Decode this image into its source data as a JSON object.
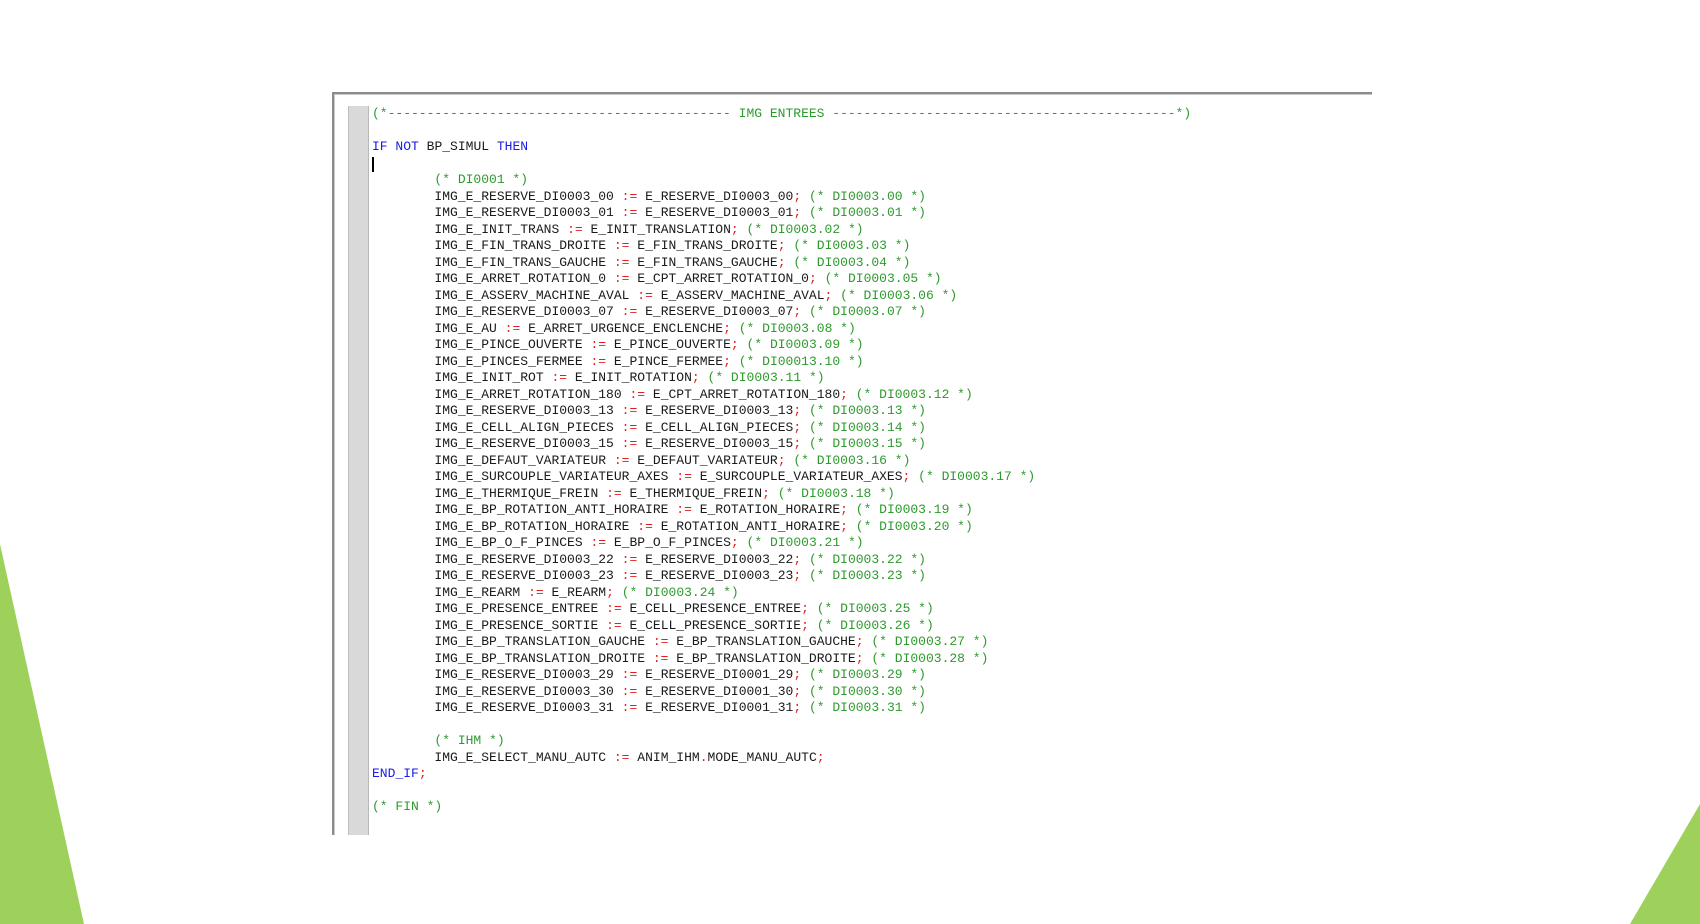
{
  "colors": {
    "keyword": "#1a1ae6",
    "comment": "#2e9a2e",
    "operator": "#e01e1e",
    "identifier": "#1a1a1a",
    "gutter": "#d9d9d9",
    "deco_green": "#9ed15b"
  },
  "code": {
    "header_comment": "(*-------------------------------------------- IMG ENTREES --------------------------------------------*)",
    "if_keyword": "IF",
    "not_keyword": "NOT",
    "condition": "BP_SIMUL",
    "then_keyword": "THEN",
    "section_di_comment": "(* DI0001 *)",
    "assignment_operator": ":=",
    "assignments": [
      {
        "lhs": "IMG_E_RESERVE_DI0003_00",
        "rhs": "E_RESERVE_DI0003_00",
        "comment": "(* DI0003.00 *)"
      },
      {
        "lhs": "IMG_E_RESERVE_DI0003_01",
        "rhs": "E_RESERVE_DI0003_01",
        "comment": "(* DI0003.01 *)"
      },
      {
        "lhs": "IMG_E_INIT_TRANS",
        "rhs": "E_INIT_TRANSLATION",
        "comment": "(* DI0003.02 *)"
      },
      {
        "lhs": "IMG_E_FIN_TRANS_DROITE",
        "rhs": "E_FIN_TRANS_DROITE",
        "comment": "(* DI0003.03 *)"
      },
      {
        "lhs": "IMG_E_FIN_TRANS_GAUCHE",
        "rhs": "E_FIN_TRANS_GAUCHE",
        "comment": "(* DI0003.04 *)"
      },
      {
        "lhs": "IMG_E_ARRET_ROTATION_0",
        "rhs": "E_CPT_ARRET_ROTATION_0",
        "comment": "(* DI0003.05 *)"
      },
      {
        "lhs": "IMG_E_ASSERV_MACHINE_AVAL",
        "rhs": "E_ASSERV_MACHINE_AVAL",
        "comment": "(* DI0003.06 *)"
      },
      {
        "lhs": "IMG_E_RESERVE_DI0003_07",
        "rhs": "E_RESERVE_DI0003_07",
        "comment": "(* DI0003.07 *)"
      },
      {
        "lhs": "IMG_E_AU",
        "rhs": "E_ARRET_URGENCE_ENCLENCHE",
        "comment": "(* DI0003.08 *)"
      },
      {
        "lhs": "IMG_E_PINCE_OUVERTE",
        "rhs": "E_PINCE_OUVERTE",
        "comment": "(* DI0003.09 *)"
      },
      {
        "lhs": "IMG_E_PINCES_FERMEE",
        "rhs": "E_PINCE_FERMEE",
        "comment": "(* DI00013.10 *)"
      },
      {
        "lhs": "IMG_E_INIT_ROT",
        "rhs": "E_INIT_ROTATION",
        "comment": "(* DI0003.11 *)"
      },
      {
        "lhs": "IMG_E_ARRET_ROTATION_180",
        "rhs": "E_CPT_ARRET_ROTATION_180",
        "comment": "(* DI0003.12 *)"
      },
      {
        "lhs": "IMG_E_RESERVE_DI0003_13",
        "rhs": "E_RESERVE_DI0003_13",
        "comment": "(* DI0003.13 *)"
      },
      {
        "lhs": "IMG_E_CELL_ALIGN_PIECES",
        "rhs": "E_CELL_ALIGN_PIECES",
        "comment": "(* DI0003.14 *)"
      },
      {
        "lhs": "IMG_E_RESERVE_DI0003_15",
        "rhs": "E_RESERVE_DI0003_15",
        "comment": "(* DI0003.15 *)"
      },
      {
        "lhs": "IMG_E_DEFAUT_VARIATEUR",
        "rhs": "E_DEFAUT_VARIATEUR",
        "comment": "(* DI0003.16 *)"
      },
      {
        "lhs": "IMG_E_SURCOUPLE_VARIATEUR_AXES",
        "rhs": "E_SURCOUPLE_VARIATEUR_AXES",
        "comment": "(* DI0003.17 *)"
      },
      {
        "lhs": "IMG_E_THERMIQUE_FREIN",
        "rhs": "E_THERMIQUE_FREIN",
        "comment": "(* DI0003.18 *)"
      },
      {
        "lhs": "IMG_E_BP_ROTATION_ANTI_HORAIRE",
        "rhs": "E_ROTATION_HORAIRE",
        "comment": "(* DI0003.19 *)"
      },
      {
        "lhs": "IMG_E_BP_ROTATION_HORAIRE",
        "rhs": "E_ROTATION_ANTI_HORAIRE",
        "comment": "(* DI0003.20 *)"
      },
      {
        "lhs": "IMG_E_BP_O_F_PINCES",
        "rhs": "E_BP_O_F_PINCES",
        "comment": "(* DI0003.21 *)"
      },
      {
        "lhs": "IMG_E_RESERVE_DI0003_22",
        "rhs": "E_RESERVE_DI0003_22",
        "comment": "(* DI0003.22 *)"
      },
      {
        "lhs": "IMG_E_RESERVE_DI0003_23",
        "rhs": "E_RESERVE_DI0003_23",
        "comment": "(* DI0003.23 *)"
      },
      {
        "lhs": "IMG_E_REARM",
        "rhs": "E_REARM",
        "comment": "(* DI0003.24 *)"
      },
      {
        "lhs": "IMG_E_PRESENCE_ENTREE",
        "rhs": "E_CELL_PRESENCE_ENTREE",
        "comment": "(* DI0003.25 *)"
      },
      {
        "lhs": "IMG_E_PRESENCE_SORTIE",
        "rhs": "E_CELL_PRESENCE_SORTIE",
        "comment": "(* DI0003.26 *)"
      },
      {
        "lhs": "IMG_E_BP_TRANSLATION_GAUCHE",
        "rhs": "E_BP_TRANSLATION_GAUCHE",
        "comment": "(* DI0003.27 *)"
      },
      {
        "lhs": "IMG_E_BP_TRANSLATION_DROITE",
        "rhs": "E_BP_TRANSLATION_DROITE",
        "comment": "(* DI0003.28 *)"
      },
      {
        "lhs": "IMG_E_RESERVE_DI0003_29",
        "rhs": "E_RESERVE_DI0001_29",
        "comment": "(* DI0003.29 *)"
      },
      {
        "lhs": "IMG_E_RESERVE_DI0003_30",
        "rhs": "E_RESERVE_DI0001_30",
        "comment": "(* DI0003.30 *)"
      },
      {
        "lhs": "IMG_E_RESERVE_DI0003_31",
        "rhs": "E_RESERVE_DI0001_31",
        "comment": "(* DI0003.31 *)"
      }
    ],
    "section_ihm_comment": "(* IHM *)",
    "ihm_lhs": "IMG_E_SELECT_MANU_AUTC",
    "ihm_rhs_obj": "ANIM_IHM",
    "ihm_rhs_field": "MODE_MANU_AUTC",
    "end_if": "END_IF",
    "fin_comment": "(* FIN *)"
  }
}
